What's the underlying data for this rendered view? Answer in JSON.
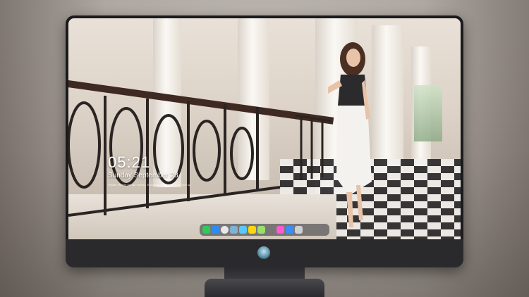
{
  "lockscreen": {
    "time": "05:21",
    "date": "Sunday September 28",
    "quote": "Private: Where jhs are flowers, Encouraged, he said never give up"
  },
  "dock": {
    "icons": [
      {
        "name": "messages-icon",
        "color": "#34c759"
      },
      {
        "name": "finder-icon",
        "color": "#2d8cf0"
      },
      {
        "name": "safari-icon",
        "color": "#e8e8ea"
      },
      {
        "name": "preview-icon",
        "color": "#7fb3d5"
      },
      {
        "name": "clapper-icon",
        "color": "#5ac8fa"
      },
      {
        "name": "notes-icon",
        "color": "#ffd60a"
      },
      {
        "name": "photos-icon",
        "color": "#9adf6b"
      },
      {
        "name": "itunes-icon",
        "color": "#ff5bd0"
      },
      {
        "name": "app-store-icon",
        "color": "#3a8ef6"
      },
      {
        "name": "camera-icon",
        "color": "#d0d0d4"
      }
    ]
  }
}
